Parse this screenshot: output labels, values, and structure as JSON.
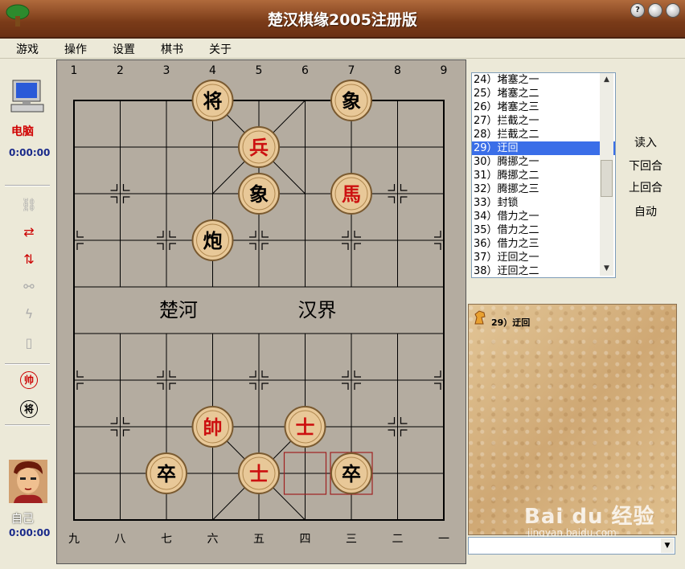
{
  "window": {
    "title": "楚汉棋缘2005注册版",
    "buttons": [
      "?",
      "",
      ""
    ]
  },
  "menu": [
    "游戏",
    "操作",
    "设置",
    "棋书",
    "关于"
  ],
  "left": {
    "computer_label": "电脑",
    "computer_time": "0:00:00",
    "player_label": "自己",
    "player_time": "0:00:00",
    "tools": [
      "link-icon",
      "swap-icon",
      "flip-icon",
      "chain-icon",
      "lightning-icon",
      "book-icon",
      "red-general-icon",
      "black-general-icon"
    ],
    "red_general_glyph": "帅",
    "black_general_glyph": "将"
  },
  "board": {
    "top_numbers": [
      "1",
      "2",
      "3",
      "4",
      "5",
      "6",
      "7",
      "8",
      "9"
    ],
    "bottom_numbers": [
      "九",
      "八",
      "七",
      "六",
      "五",
      "四",
      "三",
      "二",
      "一"
    ],
    "river_left": "楚河",
    "river_right": "汉界",
    "pieces": [
      {
        "char": "将",
        "color": "black",
        "file": 4,
        "rank": 0
      },
      {
        "char": "象",
        "color": "black",
        "file": 7,
        "rank": 0
      },
      {
        "char": "兵",
        "color": "red",
        "file": 5,
        "rank": 1
      },
      {
        "char": "象",
        "color": "black",
        "file": 5,
        "rank": 2
      },
      {
        "char": "馬",
        "color": "red",
        "file": 7,
        "rank": 2
      },
      {
        "char": "炮",
        "color": "black",
        "file": 4,
        "rank": 3
      },
      {
        "char": "帥",
        "color": "red",
        "file": 4,
        "rank": 7
      },
      {
        "char": "士",
        "color": "red",
        "file": 6,
        "rank": 7
      },
      {
        "char": "卒",
        "color": "black",
        "file": 3,
        "rank": 8
      },
      {
        "char": "士",
        "color": "red",
        "file": 5,
        "rank": 8
      },
      {
        "char": "卒",
        "color": "black",
        "file": 7,
        "rank": 8
      }
    ],
    "highlights": [
      {
        "file": 6,
        "rank": 8
      },
      {
        "file": 7,
        "rank": 8
      }
    ]
  },
  "movelist": {
    "items": [
      "24）堵塞之一",
      "25）堵塞之二",
      "26）堵塞之三",
      "27）拦截之一",
      "28）拦截之二",
      "29）迂回",
      "30）腾挪之一",
      "31）腾挪之二",
      "32）腾挪之三",
      "33）封锁",
      "34）借力之一",
      "35）借力之二",
      "36）借力之三",
      "37）迂回之一",
      "38）迂回之二"
    ],
    "selected_index": 5
  },
  "controls": {
    "load": "读入",
    "next": "下回合",
    "prev": "上回合",
    "auto": "自动"
  },
  "info": {
    "text": "29）迂回"
  },
  "watermark": {
    "main": "Bai du 经验",
    "sub": "jingyan.baidu.com"
  }
}
